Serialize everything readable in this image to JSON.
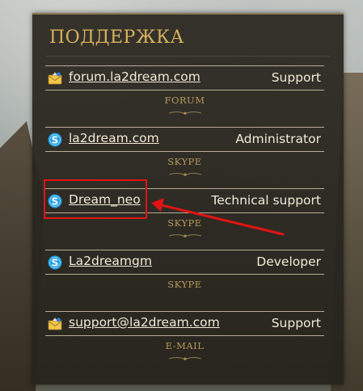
{
  "panel": {
    "title": "ПОДДЕРЖКА"
  },
  "entries": [
    {
      "icon": "mail-icon",
      "link": "forum.la2dream.com",
      "role": "Support",
      "type": "FORUM"
    },
    {
      "icon": "skype-icon",
      "link": "la2dream.com",
      "role": "Administrator",
      "type": "SKYPE"
    },
    {
      "icon": "skype-icon",
      "link": "Dream_neo",
      "role": "Technical support",
      "type": "SKYPE"
    },
    {
      "icon": "skype-icon",
      "link": "La2dreamgm",
      "role": "Developer",
      "type": "SKYPE"
    },
    {
      "icon": "mail-icon",
      "link": "support@la2dream.com",
      "role": "Support",
      "type": "E-MAIL"
    }
  ],
  "colors": {
    "title": "#d8b25e",
    "text": "#f3ead6",
    "type_label": "#b89a5a",
    "annotation": "#e01414"
  }
}
